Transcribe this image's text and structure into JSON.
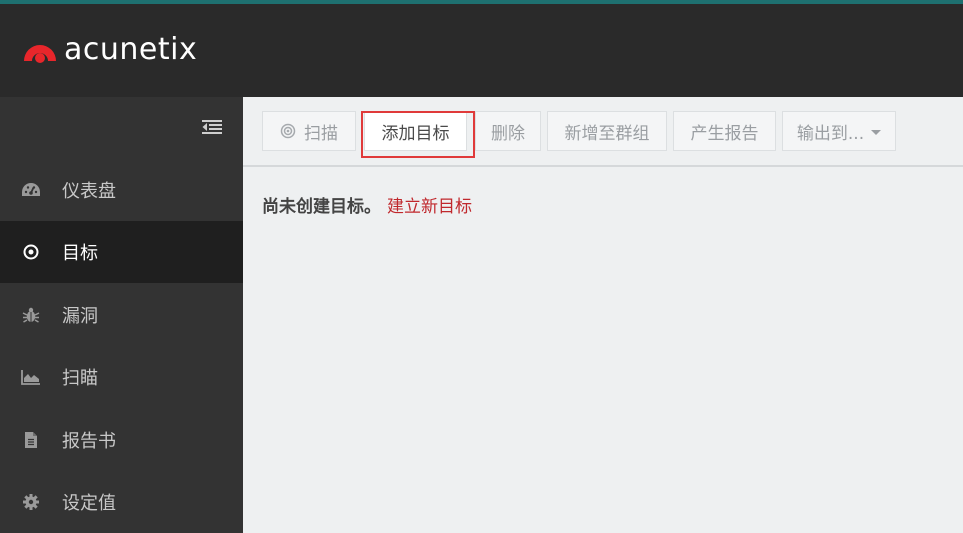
{
  "app": {
    "logo_text": "acunetix",
    "brand_color": "#e8262b",
    "accent_top_border": "#1e7070"
  },
  "sidebar": {
    "toggle_icon": "collapse-menu-icon",
    "items": [
      {
        "label": "仪表盘",
        "icon": "dashboard-icon",
        "active": false
      },
      {
        "label": "目标",
        "icon": "target-icon",
        "active": true
      },
      {
        "label": "漏洞",
        "icon": "bug-icon",
        "active": false
      },
      {
        "label": "扫瞄",
        "icon": "area-chart-icon",
        "active": false
      },
      {
        "label": "报告书",
        "icon": "document-icon",
        "active": false
      },
      {
        "label": "设定值",
        "icon": "gear-icon",
        "active": false
      }
    ]
  },
  "toolbar": {
    "scan_label": "扫描",
    "add_target_label": "添加目标",
    "delete_label": "删除",
    "add_to_group_label": "新增至群组",
    "generate_report_label": "产生报告",
    "export_label": "输出到..."
  },
  "main": {
    "empty_text": "尚未创建目标。",
    "create_link": "建立新目标"
  }
}
